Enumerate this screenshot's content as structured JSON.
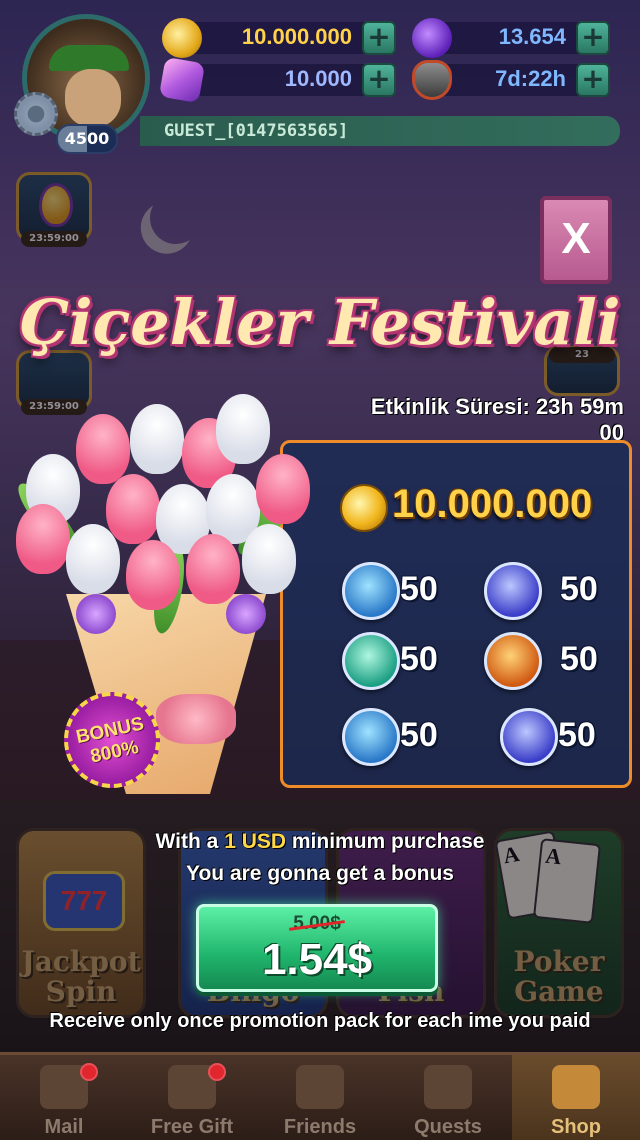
{
  "header": {
    "coins": "10.000.000",
    "energy": "13.654",
    "gems": "10.000",
    "shield_timer": "7d:22h",
    "level": "4500",
    "username": "GUEST_[0147563565]"
  },
  "side_events": {
    "left_timer_1": "23:59:00",
    "left_timer_2": "23:59:00",
    "right_badge": "23"
  },
  "popup": {
    "close_label": "X",
    "title": "Çiçekler Festivali",
    "duration": "Etkinlik Süresi: 23h 59m 00",
    "bonus_line1": "BONUS",
    "bonus_line2": "800%",
    "coin_reward": "10.000.000",
    "items": [
      {
        "icon": "swap-booster-icon",
        "count": "50"
      },
      {
        "icon": "eye-booster-icon",
        "count": "50"
      },
      {
        "icon": "auto-booster-icon",
        "count": "50"
      },
      {
        "icon": "jackpot-booster-icon",
        "count": "50"
      },
      {
        "icon": "swap-booster-icon",
        "count": "50"
      },
      {
        "icon": "eye-booster-icon",
        "count": "50"
      }
    ],
    "offer_prefix": "With a ",
    "offer_highlight": "1 USD",
    "offer_suffix": " minimum purchase",
    "offer_line2": "You are gonna get a bonus",
    "old_price": "5.00$",
    "price": "1.54$",
    "note": "Receive only once promotion pack for each ime you paid"
  },
  "games": {
    "jackpot": "Jackpot Spin",
    "slot_symbol": "777",
    "bingo": "Bingo",
    "fish": "Fish",
    "poker": "Poker Game",
    "card_rank": "A"
  },
  "nav": {
    "mail": "Mail",
    "free_gift": "Free Gift",
    "friends": "Friends",
    "quests": "Quests",
    "shop": "Shop"
  },
  "colors": {
    "accent_border": "#ef8c2a",
    "buy_green": "#1fb46b",
    "coin_gold": "#ffd24a",
    "title_pink": "#b0336f"
  }
}
